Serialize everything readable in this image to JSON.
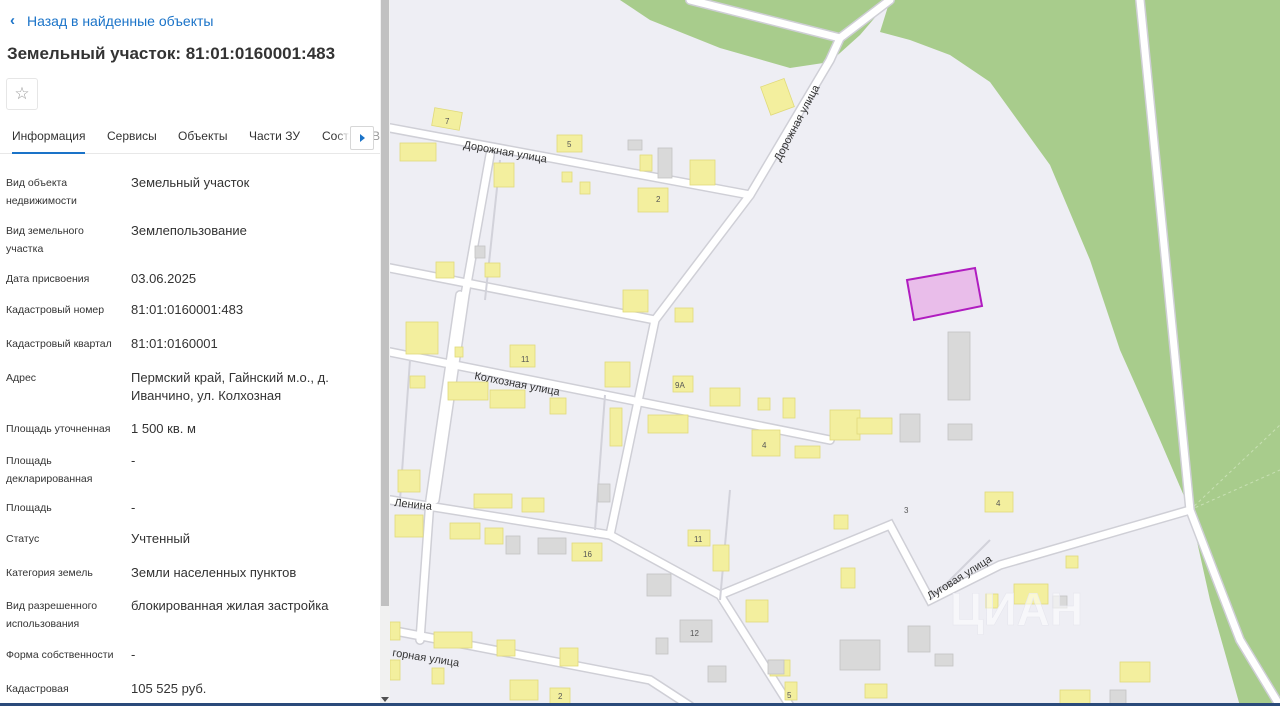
{
  "back_link": "Назад в найденные объекты",
  "title": "Земельный участок: 81:01:0160001:483",
  "tabs": [
    "Информация",
    "Сервисы",
    "Объекты",
    "Части ЗУ",
    "Соста"
  ],
  "tab_partial": "В",
  "fields": [
    {
      "label": "Вид объекта недвижимости",
      "value": "Земельный участок"
    },
    {
      "label": "Вид земельного участка",
      "value": "Землепользование"
    },
    {
      "label": "Дата присвоения",
      "value": "03.06.2025"
    },
    {
      "label": "Кадастровый номер",
      "value": "81:01:0160001:483"
    },
    {
      "label": "Кадастровый квартал",
      "value": "81:01:0160001"
    },
    {
      "label": "Адрес",
      "value": "Пермский край, Гайнский м.о., д. Иванчино, ул. Колхозная"
    },
    {
      "label": "Площадь уточненная",
      "value": "1 500 кв. м"
    },
    {
      "label": "Площадь декларированная",
      "value": "-"
    },
    {
      "label": "Площадь",
      "value": "-"
    },
    {
      "label": "Статус",
      "value": "Учтенный"
    },
    {
      "label": "Категория земель",
      "value": "Земли населенных пунктов"
    },
    {
      "label": "Вид разрешенного использования",
      "value": "блокированная жилая застройка"
    },
    {
      "label": "Форма собственности",
      "value": "-"
    },
    {
      "label": "Кадастровая",
      "value": "105 525 руб."
    }
  ],
  "map": {
    "streets": {
      "dorozhnaya_1": "Дорожная улица",
      "dorozhnaya_2": "Дорожная улица",
      "kolkhoznaya": "Колхозная улица",
      "lenina": "Ленина",
      "lugovaya": "Луговая улица",
      "gornaya": "горная улица"
    },
    "house_numbers": [
      "7",
      "5",
      "2",
      "11",
      "9А",
      "4",
      "3",
      "4",
      "11",
      "16",
      "12",
      "2",
      "5"
    ],
    "watermark": "ЦИАН",
    "colors": {
      "background": "#eeeef4",
      "forest": "#a8cc8c",
      "building": "#f3ef9e",
      "building_gray": "#d9d9d9",
      "road": "#ffffff",
      "parcel_fill": "#e8b4e8",
      "parcel_stroke": "#b01cc0"
    }
  }
}
